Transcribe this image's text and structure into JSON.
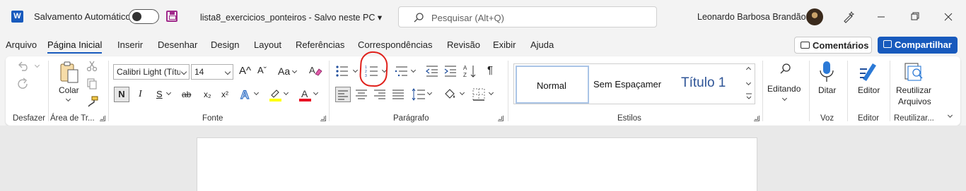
{
  "titlebar": {
    "app_logo": "W",
    "autosave_label": "Salvamento Automático",
    "autosave_state": "off",
    "doc_title": "lista8_exercicios_ponteiros  -  Salvo neste PC  ▾",
    "search_placeholder": "Pesquisar (Alt+Q)",
    "user_name": "Leonardo Barbosa Brandão"
  },
  "menu": {
    "tabs": [
      "Arquivo",
      "Página Inicial",
      "Inserir",
      "Desenhar",
      "Design",
      "Layout",
      "Referências",
      "Correspondências",
      "Revisão",
      "Exibir",
      "Ajuda"
    ],
    "active_tab": "Página Inicial",
    "comments_label": "Comentários",
    "share_label": "Compartilhar"
  },
  "ribbon": {
    "groups": {
      "undo": "Desfazer",
      "clipboard": "Área de Tr...",
      "font": "Fonte",
      "paragraph": "Parágrafo",
      "styles": "Estilos",
      "voice": "Voz",
      "editor": "Editor",
      "reuse": "Reutilizar..."
    },
    "paste_label": "Colar",
    "font_name": "Calibri Light (Títu",
    "font_size": "14",
    "change_case": "Aa",
    "grow_font": "A^",
    "shrink_font": "Aˇ",
    "bold": "N",
    "italic": "I",
    "underline": "S",
    "strike": "ab",
    "subscript": "x₂",
    "superscript": "x²",
    "styles": [
      "Normal",
      "Sem Espaçamer",
      "Título 1"
    ],
    "editing_label": "Editando",
    "dictate_label": "Ditar",
    "editor_label": "Editor",
    "reuse_label_1": "Reutilizar",
    "reuse_label_2": "Arquivos"
  },
  "colors": {
    "accent": "#185abd",
    "highlight": "#ffff00",
    "font_color": "#e81123",
    "annotation": "#e0201b"
  }
}
